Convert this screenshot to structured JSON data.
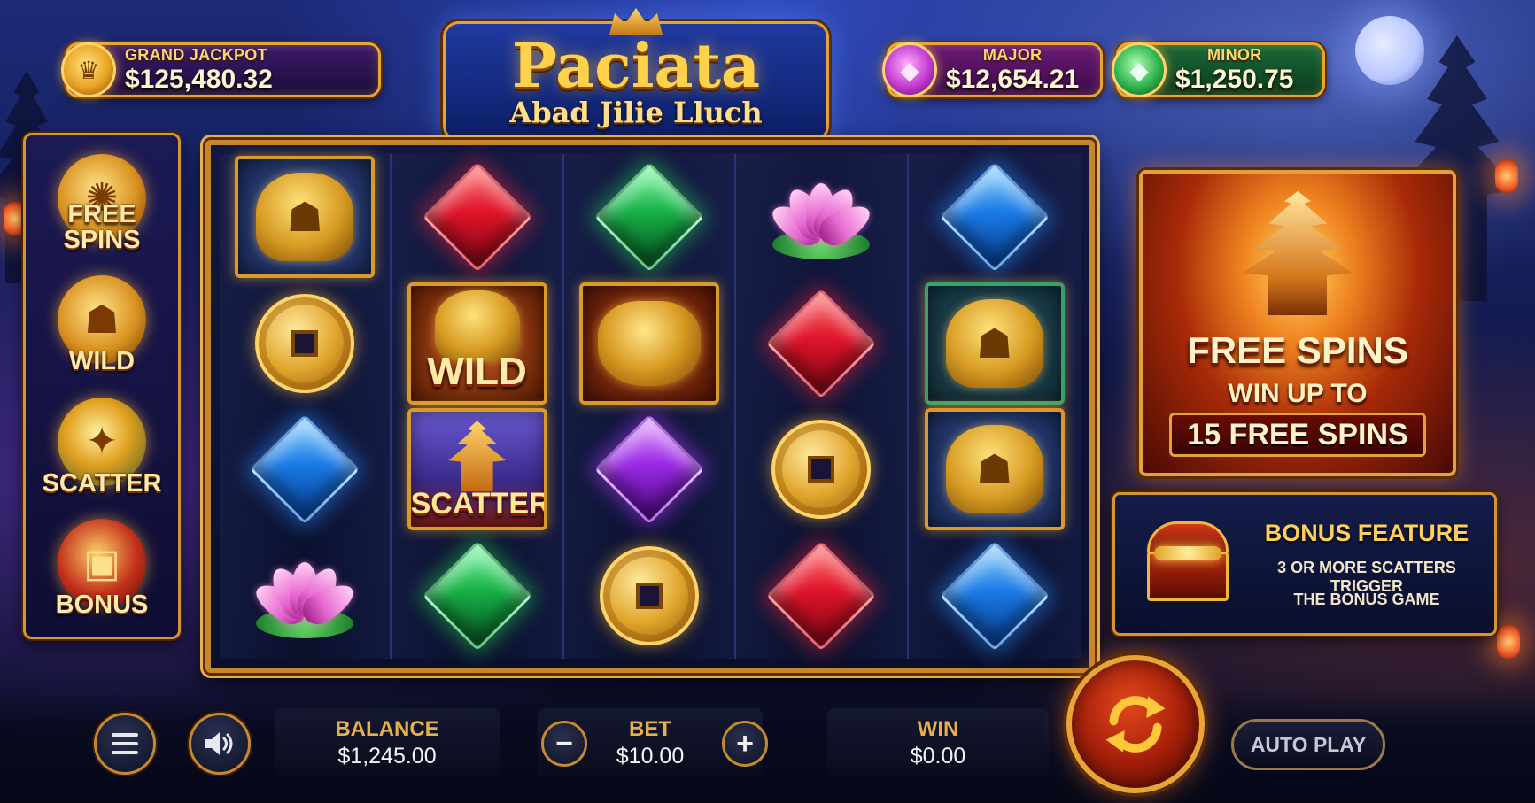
{
  "jackpots": {
    "grand": {
      "label": "GRAND JACKPOT",
      "value": "$125,480.32"
    },
    "major": {
      "label": "MAJOR",
      "value": "$12,654.21"
    },
    "minor": {
      "label": "MINOR",
      "value": "$1,250.75"
    }
  },
  "logo": {
    "title": "Paciata",
    "subtitle": "Abad Jilie Lluch"
  },
  "paytable": [
    {
      "label": "FREE SPINS",
      "icon": "coin-emblem-icon"
    },
    {
      "label": "WILD",
      "icon": "lion-emblem-icon"
    },
    {
      "label": "SCATTER",
      "icon": "lantern-emblem-icon"
    },
    {
      "label": "BONUS",
      "icon": "treasure-chest-icon"
    }
  ],
  "reels": [
    [
      "lion",
      "coin",
      "gem-blue",
      "lotus"
    ],
    [
      "gem-red",
      "wild",
      "scatter",
      "gem-green"
    ],
    [
      "gem-green",
      "pot",
      "gem-purple",
      "coin"
    ],
    [
      "lotus",
      "gem-red",
      "coin",
      "gem-red"
    ],
    [
      "gem-blue",
      "lion-green",
      "lion",
      "gem-blue"
    ]
  ],
  "symbol_labels": {
    "wild": "WILD",
    "scatter": "SCATTER"
  },
  "promo_free_spins": {
    "title": "FREE SPINS",
    "line1": "WIN UP TO",
    "line2": "15 FREE SPINS"
  },
  "promo_bonus": {
    "title": "BONUS FEATURE",
    "line1": "3 OR MORE SCATTERS TRIGGER",
    "line2": "THE BONUS GAME"
  },
  "controls": {
    "menu_icon": "hamburger-menu-icon",
    "sound_icon": "speaker-icon",
    "balance_label": "BALANCE",
    "balance_value": "$1,245.00",
    "bet_label": "BET",
    "bet_value": "$10.00",
    "bet_minus": "−",
    "bet_plus": "+",
    "win_label": "WIN",
    "win_value": "$0.00",
    "spin_icon": "spin-arrows-icon",
    "autoplay_label": "AUTO PLAY"
  },
  "colors": {
    "gold": "#e8a531",
    "spin_red": "#a8200a",
    "label_gold": "#e8b04a"
  }
}
